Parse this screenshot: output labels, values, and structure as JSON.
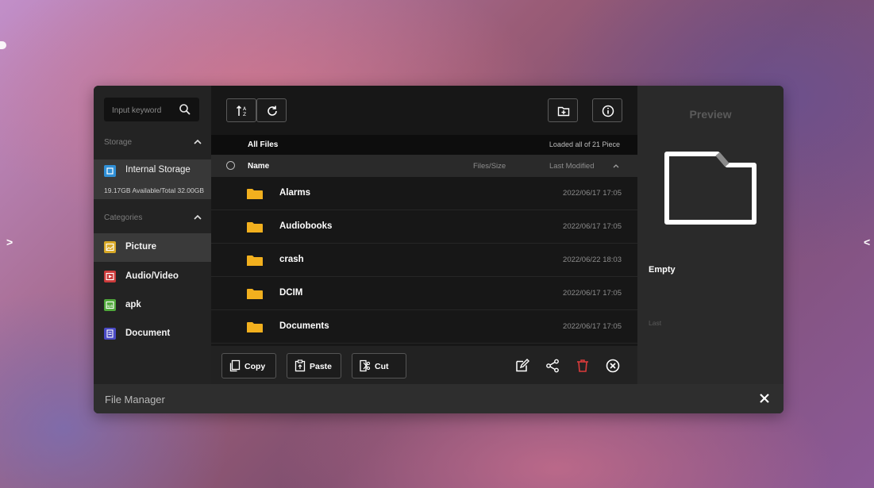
{
  "desktop": {
    "left_arrow": ">",
    "right_arrow": "<"
  },
  "search": {
    "placeholder": "Input keyword"
  },
  "sidebar": {
    "storage_header": "Storage",
    "storage_item": {
      "label": "Internal Storage",
      "capacity": "19.17GB Available/Total 32.00GB",
      "icon": "storage-icon"
    },
    "categories_header": "Categories",
    "categories": [
      {
        "label": "Picture",
        "icon": "picture-icon",
        "color": "#d8a825"
      },
      {
        "label": "Audio/Video",
        "icon": "audio-video-icon",
        "color": "#cc3a3a"
      },
      {
        "label": "apk",
        "icon": "apk-icon",
        "color": "#4fa83a"
      },
      {
        "label": "Document",
        "icon": "document-icon",
        "color": "#4a4ac4"
      }
    ]
  },
  "toolbar": {
    "sort": "sort-icon",
    "refresh": "refresh-icon",
    "new_folder": "new-folder-icon",
    "info": "info-icon"
  },
  "file_list": {
    "title": "All Files",
    "status": "Loaded all of 21 Piece",
    "columns": {
      "name": "Name",
      "size": "Files/Size",
      "modified": "Last Modified"
    },
    "rows": [
      {
        "name": "Alarms",
        "date": "2022/06/17 17:05"
      },
      {
        "name": "Audiobooks",
        "date": "2022/06/17 17:05"
      },
      {
        "name": "crash",
        "date": "2022/06/22 18:03"
      },
      {
        "name": "DCIM",
        "date": "2022/06/17 17:05"
      },
      {
        "name": "Documents",
        "date": "2022/06/17 17:05"
      }
    ]
  },
  "actions": {
    "copy": "Copy",
    "paste": "Paste",
    "cut": "Cut"
  },
  "preview": {
    "title": "Preview",
    "empty": "Empty",
    "last": "Last"
  },
  "footer": {
    "title": "File Manager"
  },
  "colors": {
    "accent_folder": "#f2b01e",
    "delete": "#d93b3b",
    "storage": "#2f8fd6"
  }
}
